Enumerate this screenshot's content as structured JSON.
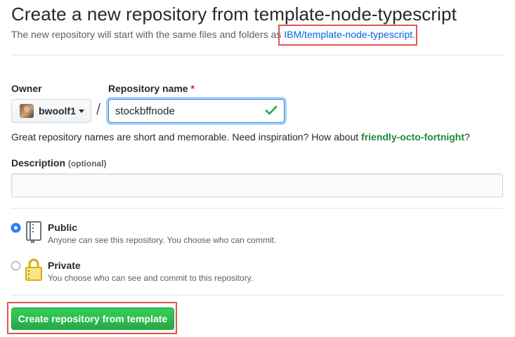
{
  "header": {
    "title": "Create a new repository from template-node-typescript",
    "subtitle_prefix": "The new repository will start with the same files and folders as ",
    "template_link": "IBM/template-node-typescript",
    "subtitle_suffix": "."
  },
  "form": {
    "owner_label": "Owner",
    "owner_value": "bwoolf1",
    "separator": "/",
    "repo_label": "Repository name",
    "required_mark": "*",
    "repo_value": "stockbffnode",
    "hint_prefix": "Great repository names are short and memorable. Need inspiration? How about ",
    "hint_suggestion": "friendly-octo-fortnight",
    "hint_suffix": "?",
    "description_label": "Description",
    "description_optional": "(optional)",
    "description_value": ""
  },
  "visibility": {
    "public": {
      "title": "Public",
      "desc": "Anyone can see this repository. You choose who can commit.",
      "selected": true
    },
    "private": {
      "title": "Private",
      "desc": "You choose who can see and commit to this repository.",
      "selected": false
    }
  },
  "actions": {
    "create_label": "Create repository from template"
  },
  "colors": {
    "accent_green": "#28a745",
    "link_blue": "#0366d6",
    "highlight_red": "#e0554f"
  }
}
